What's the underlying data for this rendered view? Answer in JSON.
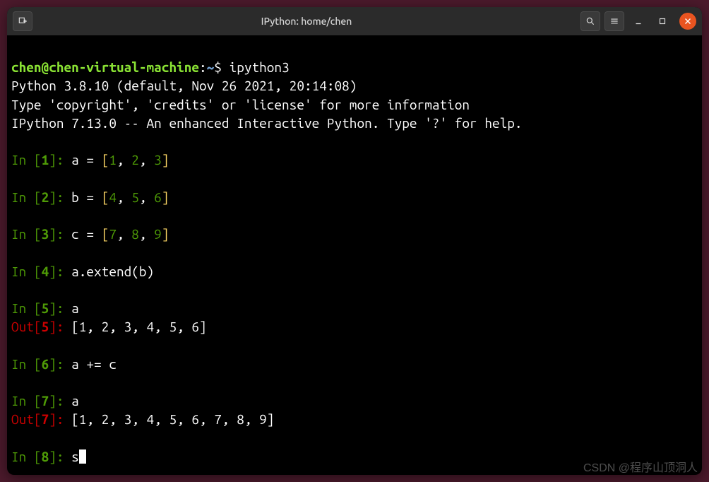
{
  "titlebar": {
    "title": "IPython: home/chen"
  },
  "prompt": {
    "user_host": "chen@chen-virtual-machine",
    "colon": ":",
    "cwd": "~",
    "dollar": "$ ",
    "command": "ipython3"
  },
  "banner": {
    "line1": "Python 3.8.10 (default, Nov 26 2021, 20:14:08)",
    "line2": "Type 'copyright', 'credits' or 'license' for more information",
    "line3": "IPython 7.13.0 -- An enhanced Interactive Python. Type '?' for help."
  },
  "cells": {
    "c1": {
      "num": "1",
      "code": "a = ",
      "list_open": "[",
      "v1": "1",
      "v2": "2",
      "v3": "3",
      "list_close": "]"
    },
    "c2": {
      "num": "2",
      "code": "b = ",
      "list_open": "[",
      "v1": "4",
      "v2": "5",
      "v3": "6",
      "list_close": "]"
    },
    "c3": {
      "num": "3",
      "code": "c = ",
      "list_open": "[",
      "v1": "7",
      "v2": "8",
      "v3": "9",
      "list_close": "]"
    },
    "c4": {
      "num": "4",
      "code": "a.extend(b)"
    },
    "c5": {
      "num": "5",
      "code": "a",
      "out": "[1, 2, 3, 4, 5, 6]"
    },
    "c6": {
      "num": "6",
      "code": "a += c"
    },
    "c7": {
      "num": "7",
      "code": "a",
      "out": "[1, 2, 3, 4, 5, 6, 7, 8, 9]"
    },
    "c8": {
      "num": "8",
      "code": "s"
    }
  },
  "tokens": {
    "in_label": "In ",
    "out_label": "Out",
    "lbr": "[",
    "rbr": "]",
    "colon_space": ": ",
    "comma": ", "
  },
  "watermark": "CSDN @程序山顶洞人"
}
